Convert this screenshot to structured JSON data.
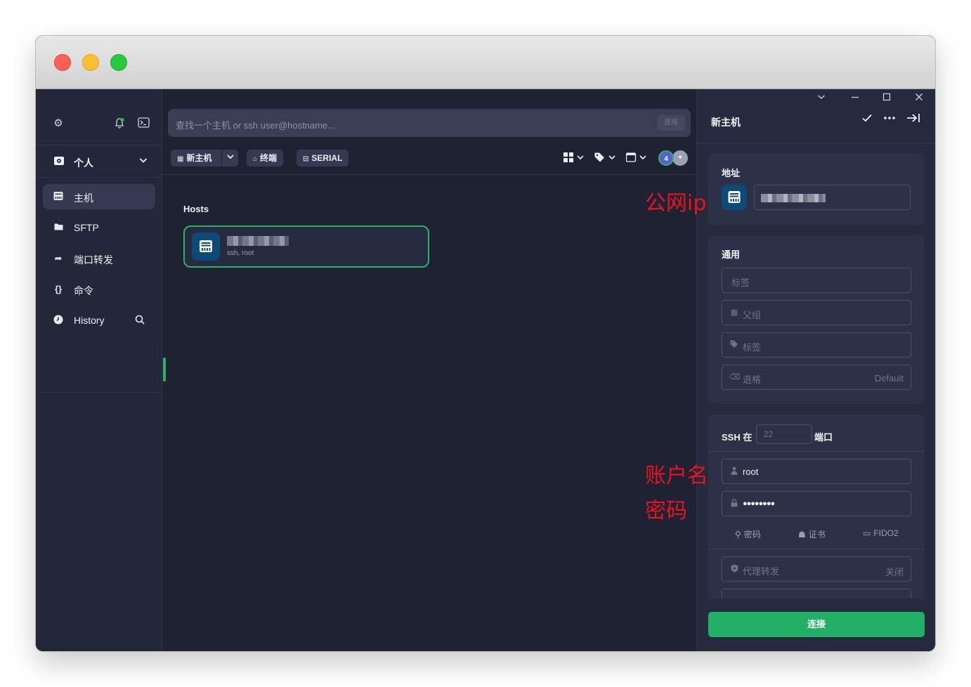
{
  "sidebar": {
    "vault": {
      "label": "个人"
    },
    "items": [
      {
        "label": "主机",
        "icon": "server-icon",
        "active": true
      },
      {
        "label": "SFTP",
        "icon": "folder-icon"
      },
      {
        "label": "端口转发",
        "icon": "port-forward-icon"
      },
      {
        "label": "命令",
        "icon": "braces-icon"
      },
      {
        "label": "History",
        "icon": "clock-icon"
      }
    ]
  },
  "search": {
    "placeholder": "查找一个主机 or ssh user@hostname...",
    "button": "连接"
  },
  "toolbar": {
    "new_host": "新主机",
    "terminal": "终端",
    "serial": "SERIAL",
    "avatar_count": "4",
    "avatar_add": "+"
  },
  "hosts": {
    "title": "Hosts",
    "items": [
      {
        "subtitle": "ssh, root"
      }
    ]
  },
  "panel": {
    "title": "新主机",
    "address": {
      "title": "地址"
    },
    "general": {
      "title": "通用",
      "label_placeholder": "标签",
      "parent_group_placeholder": "父组",
      "tags_placeholder": "标签",
      "backspace_label": "退格",
      "backspace_value": "Default"
    },
    "ssh": {
      "title_prefix": "SSH 在",
      "port_placeholder": "22",
      "title_suffix": "端口",
      "username": "root",
      "password": "●●●●●●●●",
      "auth_tabs": [
        "密码",
        "证书",
        "FIDO2"
      ],
      "agent_forwarding_label": "代理转发",
      "agent_forwarding_value": "关闭"
    },
    "connect": "连接"
  },
  "annotations": {
    "public_ip": "公网ip",
    "account": "账户名",
    "password": "密码"
  },
  "colors": {
    "accent": "#22b067",
    "host_icon_bg": "#0c4a78",
    "annotation": "#e8141e"
  }
}
